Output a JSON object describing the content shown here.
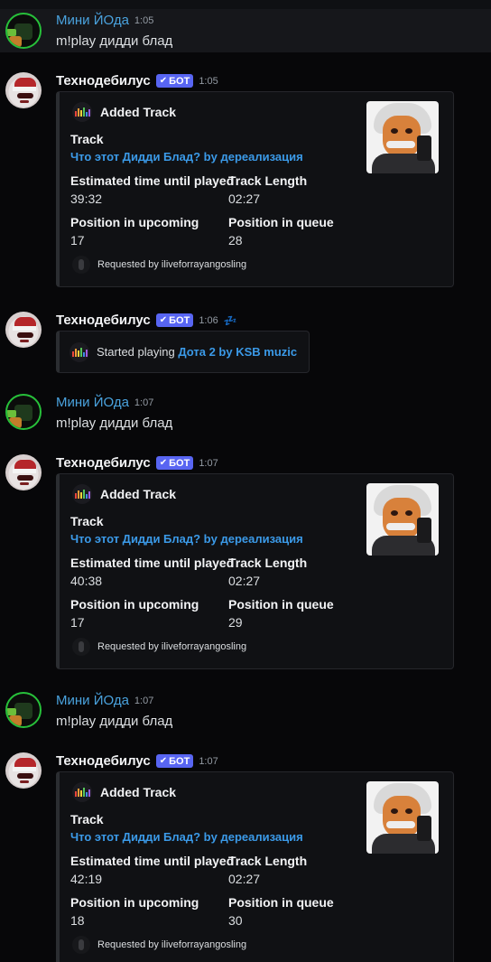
{
  "users": {
    "yoda": "Мини ЙОда",
    "bot": "Технодебилус",
    "bot_tag": "БОТ"
  },
  "messages": [
    {
      "type": "user",
      "time": "1:05",
      "text": "m!play дидди блад"
    },
    {
      "type": "track",
      "time": "1:05",
      "embed": {
        "author": "Added Track",
        "track_label": "Track",
        "track_title": "Что этот Дидди Блад? by дереализация",
        "est_label": "Estimated time until played",
        "est_value": "39:32",
        "len_label": "Track Length",
        "len_value": "02:27",
        "pos_up_label": "Position in upcoming",
        "pos_up_value": "17",
        "pos_q_label": "Position in queue",
        "pos_q_value": "28",
        "footer": "Requested by iliveforrayangosling"
      }
    },
    {
      "type": "playing",
      "time": "1:06",
      "prefix": "Started playing ",
      "track": "Дота 2 by KSB muzic"
    },
    {
      "type": "user",
      "time": "1:07",
      "text": "m!play дидди блад"
    },
    {
      "type": "track",
      "time": "1:07",
      "embed": {
        "author": "Added Track",
        "track_label": "Track",
        "track_title": "Что этот Дидди Блад? by дереализация",
        "est_label": "Estimated time until played",
        "est_value": "40:38",
        "len_label": "Track Length",
        "len_value": "02:27",
        "pos_up_label": "Position in upcoming",
        "pos_up_value": "17",
        "pos_q_label": "Position in queue",
        "pos_q_value": "29",
        "footer": "Requested by iliveforrayangosling"
      }
    },
    {
      "type": "user",
      "time": "1:07",
      "text": "m!play дидди блад"
    },
    {
      "type": "track",
      "time": "1:07",
      "embed": {
        "author": "Added Track",
        "track_label": "Track",
        "track_title": "Что этот Дидди Блад? by дереализация",
        "est_label": "Estimated time until played",
        "est_value": "42:19",
        "len_label": "Track Length",
        "len_value": "02:27",
        "pos_up_label": "Position in upcoming",
        "pos_up_value": "18",
        "pos_q_label": "Position in queue",
        "pos_q_value": "30",
        "footer": "Requested by iliveforrayangosling"
      }
    }
  ],
  "icons": {
    "check": "✔",
    "snooze": "💤",
    "bot_avatar": "santa-robot-avatar-icon",
    "user_avatar": "yoda-avatar-icon",
    "thumbnail": "einstein-thumbnail"
  },
  "colors": {
    "bot_tag": "#5865f2",
    "user_name": "#4aa3df",
    "link": "#3b9ae8",
    "background": "#070709"
  }
}
